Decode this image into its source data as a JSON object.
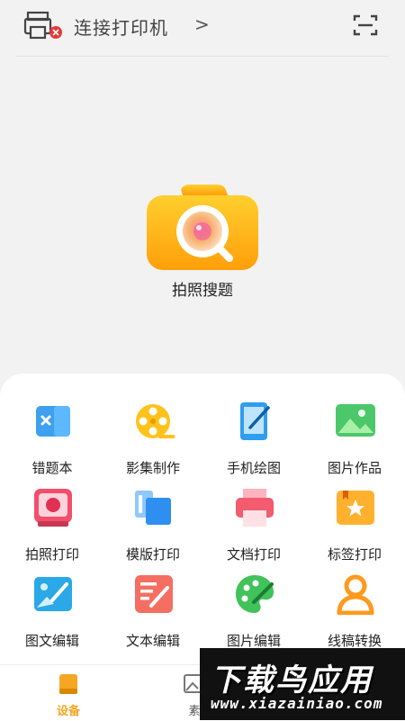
{
  "header": {
    "connect_label": "连接打印机",
    "chevron": ">"
  },
  "main": {
    "camera_label": "拍照搜题"
  },
  "grid": {
    "items": [
      {
        "label": "错题本",
        "icon": "wrong-book-icon"
      },
      {
        "label": "影集制作",
        "icon": "film-reel-icon"
      },
      {
        "label": "手机绘图",
        "icon": "phone-drawing-icon"
      },
      {
        "label": "图片作品",
        "icon": "picture-gallery-icon"
      },
      {
        "label": "拍照打印",
        "icon": "photo-print-icon"
      },
      {
        "label": "模版打印",
        "icon": "template-print-icon"
      },
      {
        "label": "文档打印",
        "icon": "document-print-icon"
      },
      {
        "label": "标签打印",
        "icon": "label-print-icon"
      },
      {
        "label": "图文编辑",
        "icon": "image-text-edit-icon"
      },
      {
        "label": "文本编辑",
        "icon": "text-edit-icon"
      },
      {
        "label": "图片编辑",
        "icon": "palette-icon"
      },
      {
        "label": "线稿转换",
        "icon": "line-art-icon"
      }
    ]
  },
  "tabbar": {
    "tabs": [
      {
        "label": "设备",
        "active": true
      },
      {
        "label": "素",
        "active": false
      }
    ]
  },
  "watermark": {
    "title": "下载鸟应用",
    "url": "www.xiazainiao.com"
  },
  "colors": {
    "accent": "#f5a623",
    "background": "#f2f2f2",
    "panel": "#ffffff"
  }
}
